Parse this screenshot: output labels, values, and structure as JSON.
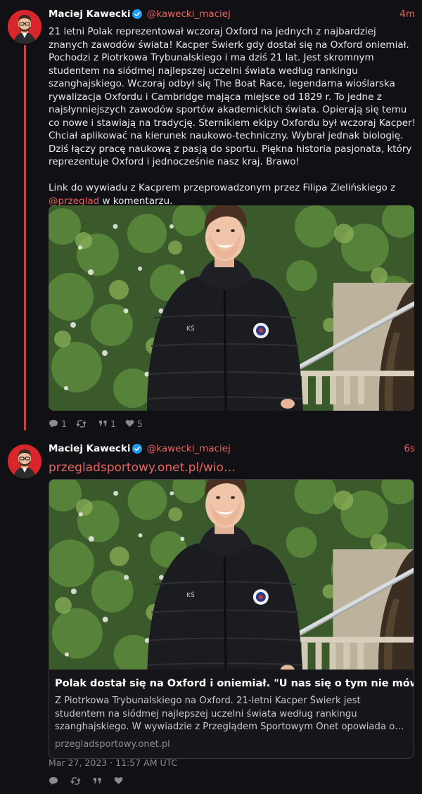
{
  "colors": {
    "background": "#111115",
    "accent": "#e8645f",
    "thread_line": "#c4434a",
    "verified": "#1d9bf0"
  },
  "posts": [
    {
      "author": {
        "name": "Maciej Kawecki",
        "handle": "@kawecki_maciej",
        "avatar_icon": "avatar-portrait-icon",
        "verified_icon": "verified-badge-icon"
      },
      "time": "4m",
      "body": {
        "paragraph1": "21 letni Polak reprezentował wczoraj Oxford na jednych z najbardziej znanych zawodów świata! Kacper Świerk gdy dostał się na Oxford oniemiał. Pochodzi z Piotrkowa Trybunalskiego i ma dziś 21 lat. Jest skromnym studentem na siódmej najlepszej uczelni świata według rankingu szanghajskiego. Wczoraj odbył się The Boat Race, legendarna wioślarska rywalizacja Oxfordu i Cambridge mająca miejsce od 1829 r. To jedne z najsłynniejszych zawodów sportów akademickich świata. Opierają się temu co nowe i stawiają na tradycję. Sternikiem ekipy Oxfordu był wczoraj Kacper! Chciał aplikować na kierunek naukowo-techniczny. Wybrał jednak biologię. Dziś łączy pracę naukową z pasją do sportu. Piękna historia pasjonata, który reprezentuje Oxford i jednocześnie nasz kraj. Brawo!",
        "paragraph2_before": "Link do wywiadu z Kacprem przeprowadzonym przez Filipa Zielińskiego z ",
        "paragraph2_mention": "@przeglad",
        "paragraph2_after": " w komentarzu."
      },
      "media": {
        "icon": "photo-young-man-black-jacket"
      },
      "stats": {
        "replies": "1",
        "reposts": "",
        "quotes": "1",
        "likes": "5"
      }
    },
    {
      "author": {
        "name": "Maciej Kawecki",
        "handle": "@kawecki_maciej",
        "avatar_icon": "avatar-portrait-icon",
        "verified_icon": "verified-badge-icon"
      },
      "time": "6s",
      "link_text": "przegladsportowy.onet.pl/wio…",
      "card": {
        "image_icon": "photo-young-man-black-jacket",
        "title": "Polak dostał się na Oxford i oniemiał. \"U nas się o tym nie mówi\"",
        "description": "Z Piotrkowa Trybunalskiego na Oxford. 21-letni Kacper Świerk jest studentem na siódmej najlepszej uczelni świata według rankingu szanghajskiego. W wywiadzie z Przeglądem Sportowym Onet opowiada o…",
        "domain": "przegladsportowy.onet.pl"
      },
      "date": "Mar 27, 2023 · 11:57 AM UTC",
      "stats": {
        "replies": "",
        "reposts": "",
        "quotes": "",
        "likes": ""
      }
    }
  ]
}
